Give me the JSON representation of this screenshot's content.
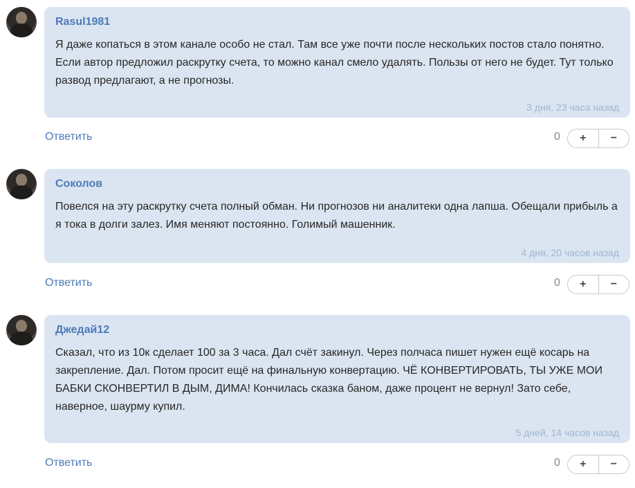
{
  "comments": [
    {
      "author": "Rasul1981",
      "text": "Я даже копаться в этом канале особо не стал. Там все уже почти после нескольких постов стало понятно. Если автор предложил раскрутку счета, то можно канал смело удалять. Пользы от него не будет. Тут только развод предлагают, а не прогнозы.",
      "time": "3 дня, 23 часа назад",
      "reply_label": "Ответить",
      "score": "0",
      "upvote": "+",
      "downvote": "−"
    },
    {
      "author": "Соколов",
      "text": "Повелся на эту раскрутку счета полный обман. Ни прогнозов ни аналитеки одна лапша. Обещали прибыль а я тока в долги залез. Имя меняют постоянно. Голимый машенник.",
      "time": "4 дня, 20 часов назад",
      "reply_label": "Ответить",
      "score": "0",
      "upvote": "+",
      "downvote": "−"
    },
    {
      "author": "Джедай12",
      "text": "Сказал, что из 10к сделает 100 за 3 часа. Дал счёт закинул. Через полчаса пишет нужен ещё косарь на закрепление. Дал. Потом просит ещё на финальную конвертацию. ЧЁ КОНВЕРТИРОВАТЬ, ТЫ УЖЕ МОИ БАБКИ СКОНВЕРТИЛ В ДЫМ, ДИМА! Кончилась сказка баном, даже процент не вернул! Зато себе, наверное, шаурму купил.",
      "time": "5 дней, 14 часов назад",
      "reply_label": "Ответить",
      "score": "0",
      "upvote": "+",
      "downvote": "−"
    }
  ]
}
